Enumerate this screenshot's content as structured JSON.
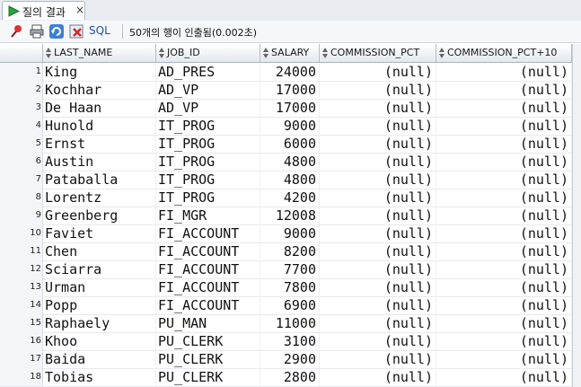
{
  "tab": {
    "title": "질의 결과",
    "close": "×"
  },
  "toolbar": {
    "sql_label": "SQL",
    "status": "50개의 행이 인출됨(0.002초)"
  },
  "columns": [
    "LAST_NAME",
    "JOB_ID",
    "SALARY",
    "COMMISSION_PCT",
    "COMMISSION_PCT+10"
  ],
  "rows": [
    {
      "n": "1",
      "last_name": "King",
      "job_id": "AD_PRES",
      "salary": "24000",
      "pct": "(null)",
      "pct10": "(null)"
    },
    {
      "n": "2",
      "last_name": "Kochhar",
      "job_id": "AD_VP",
      "salary": "17000",
      "pct": "(null)",
      "pct10": "(null)"
    },
    {
      "n": "3",
      "last_name": "De Haan",
      "job_id": "AD_VP",
      "salary": "17000",
      "pct": "(null)",
      "pct10": "(null)"
    },
    {
      "n": "4",
      "last_name": "Hunold",
      "job_id": "IT_PROG",
      "salary": "9000",
      "pct": "(null)",
      "pct10": "(null)"
    },
    {
      "n": "5",
      "last_name": "Ernst",
      "job_id": "IT_PROG",
      "salary": "6000",
      "pct": "(null)",
      "pct10": "(null)"
    },
    {
      "n": "6",
      "last_name": "Austin",
      "job_id": "IT_PROG",
      "salary": "4800",
      "pct": "(null)",
      "pct10": "(null)"
    },
    {
      "n": "7",
      "last_name": "Pataballa",
      "job_id": "IT_PROG",
      "salary": "4800",
      "pct": "(null)",
      "pct10": "(null)"
    },
    {
      "n": "8",
      "last_name": "Lorentz",
      "job_id": "IT_PROG",
      "salary": "4200",
      "pct": "(null)",
      "pct10": "(null)"
    },
    {
      "n": "9",
      "last_name": "Greenberg",
      "job_id": "FI_MGR",
      "salary": "12008",
      "pct": "(null)",
      "pct10": "(null)"
    },
    {
      "n": "10",
      "last_name": "Faviet",
      "job_id": "FI_ACCOUNT",
      "salary": "9000",
      "pct": "(null)",
      "pct10": "(null)"
    },
    {
      "n": "11",
      "last_name": "Chen",
      "job_id": "FI_ACCOUNT",
      "salary": "8200",
      "pct": "(null)",
      "pct10": "(null)"
    },
    {
      "n": "12",
      "last_name": "Sciarra",
      "job_id": "FI_ACCOUNT",
      "salary": "7700",
      "pct": "(null)",
      "pct10": "(null)"
    },
    {
      "n": "13",
      "last_name": "Urman",
      "job_id": "FI_ACCOUNT",
      "salary": "7800",
      "pct": "(null)",
      "pct10": "(null)"
    },
    {
      "n": "14",
      "last_name": "Popp",
      "job_id": "FI_ACCOUNT",
      "salary": "6900",
      "pct": "(null)",
      "pct10": "(null)"
    },
    {
      "n": "15",
      "last_name": "Raphaely",
      "job_id": "PU_MAN",
      "salary": "11000",
      "pct": "(null)",
      "pct10": "(null)"
    },
    {
      "n": "16",
      "last_name": "Khoo",
      "job_id": "PU_CLERK",
      "salary": "3100",
      "pct": "(null)",
      "pct10": "(null)"
    },
    {
      "n": "17",
      "last_name": "Baida",
      "job_id": "PU_CLERK",
      "salary": "2900",
      "pct": "(null)",
      "pct10": "(null)"
    },
    {
      "n": "18",
      "last_name": "Tobias",
      "job_id": "PU_CLERK",
      "salary": "2800",
      "pct": "(null)",
      "pct10": "(null)"
    }
  ]
}
